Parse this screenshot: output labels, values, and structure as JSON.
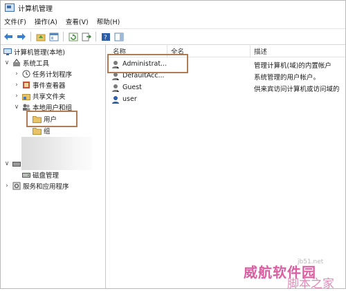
{
  "window": {
    "title": "计算机管理",
    "icon": "computer-management-icon"
  },
  "menu": [
    "文件(F)",
    "操作(A)",
    "查看(V)",
    "帮助(H)"
  ],
  "toolbar": {
    "buttons": [
      "back-arrow-icon",
      "forward-arrow-icon",
      "up-folder-icon",
      "show-tree-icon",
      "refresh-icon",
      "export-list-icon",
      "help-icon",
      "action-pane-icon"
    ]
  },
  "tree": {
    "root": "计算机管理(本地)",
    "system_tools": "系统工具",
    "task_scheduler": "任务计划程序",
    "event_viewer": "事件查看器",
    "shared_folders": "共享文件夹",
    "local_users_groups": "本地用户和组",
    "users": "用户",
    "groups": "组",
    "disk_management": "磁盘管理",
    "services_apps": "服务和应用程序",
    "expand_open": "∨",
    "expand_closed": "›"
  },
  "list": {
    "columns": [
      "名称",
      "全名",
      "描述"
    ],
    "rows": [
      {
        "name": "Administrat...",
        "description": "管理计算机(域)的内置帐户"
      },
      {
        "name": "DefaultAcc...",
        "description": "系统管理的用户帐户。"
      },
      {
        "name": "Guest",
        "description": "供来宾访问计算机或访问域的"
      },
      {
        "name": "user",
        "description": ""
      }
    ]
  },
  "watermark": {
    "url": "jb51.net",
    "line1": "威航软件园",
    "line2": "脚本之家"
  },
  "colors": {
    "highlight_border": "#b07a52",
    "folder": "#e8c468",
    "watermark_pink": "#d9529a"
  }
}
